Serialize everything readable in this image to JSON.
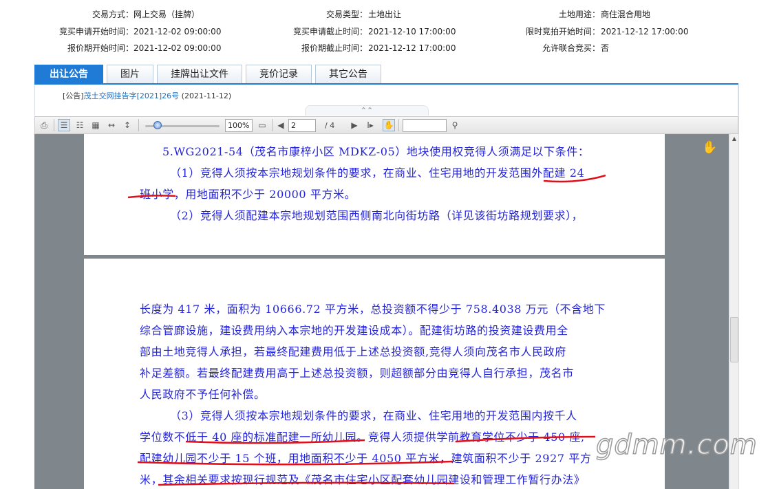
{
  "info": {
    "row1": {
      "l1": "交易方式：",
      "v1": "网上交易（挂牌）",
      "l2": "交易类型：",
      "v2": "土地出让",
      "l3": "土地用途：",
      "v3": "商住混合用地"
    },
    "row2": {
      "l1": "竞买申请开始时间：",
      "v1": "2021-12-02 09:00:00",
      "l2": "竞买申请截止时间：",
      "v2": "2021-12-10 17:00:00",
      "l3": "限时竞拍开始时间：",
      "v3": "2021-12-12 17:00:00"
    },
    "row3": {
      "l1": "报价期开始时间：",
      "v1": "2021-12-02 09:00:00",
      "l2": "报价期截止时间：",
      "v2": "2021-12-12 17:00:00",
      "l3": "允许联合竞买：",
      "v3": "否"
    }
  },
  "tabs": [
    "出让公告",
    "图片",
    "挂牌出让文件",
    "竞价记录",
    "其它公告"
  ],
  "notice": {
    "prefix": "[公告]",
    "link": "茂土交网挂告字[2021]26号",
    "date": "(2021-11-12)"
  },
  "toolbar": {
    "zoom": "100%",
    "page": "2",
    "total": "/ 4",
    "search": ""
  },
  "doc": {
    "page1": [
      "5.WG2021-54（茂名市康梓小区 MDKZ-05）地块使用权竞得人须满足以下条件：",
      "（1）竞得人须按本宗地规划条件的要求，在商业、住宅用地的开发范围外配建 24",
      "班小学，用地面积不少于 20000 平方米。",
      "（2）竞得人须配建本宗地规划范围西侧南北向街坊路（详见该街坊路规划要求），"
    ],
    "page2": [
      "长度为 417 米，面积为 10666.72 平方米，总投资额不得少于 758.4038 万元（不含地下",
      "综合管廊设施，建设费用纳入本宗地的开发建设成本）。配建街坊路的投资建设费用全",
      "部由土地竞得人承担，若最终配建费用低于上述总投资额,竞得人须向茂名市人民政府",
      "补足差额。若最终配建费用高于上述总投资额，则超额部分由竞得人自行承担，茂名市",
      "人民政府不予任何补偿。",
      "（3）竞得人须按本宗地规划条件的要求，在商业、住宅用地的开发范围内按千人",
      "学位数不低于 40 座的标准配建一所幼儿园。竞得人须提供学前教育学位不少于 450 座,",
      "配建幼儿园不少于 15 个班，用地面积不少于 4050 平方米，建筑面积不少于 2927 平方",
      "米，其余相关要求按现行规范及《茂名市住宅小区配套幼儿园建设和管理工作暂行办法》"
    ]
  },
  "watermark": "gdmm.com",
  "colors": {
    "accent": "#1f7bd6",
    "doc_text": "#2424d8",
    "annotation": "#e0101a"
  }
}
